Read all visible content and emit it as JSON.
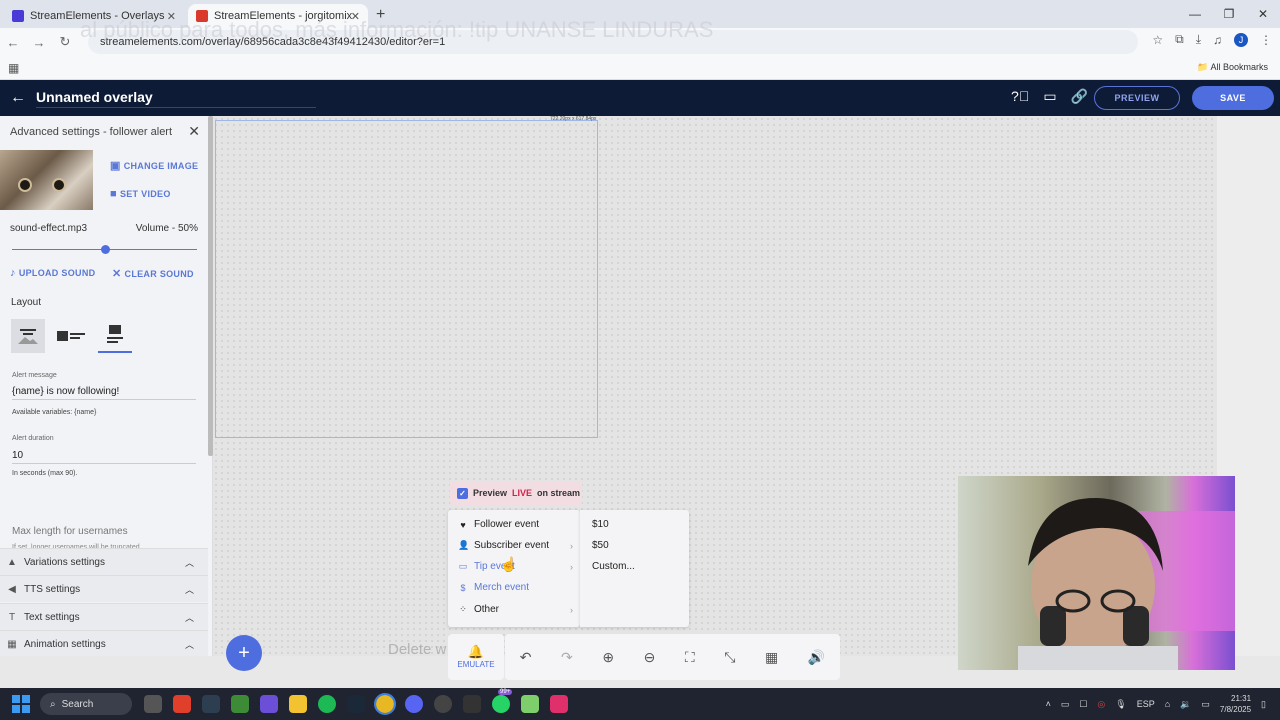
{
  "browser": {
    "tabs": [
      {
        "title": "StreamElements - Overlays"
      },
      {
        "title": "StreamElements - jorgitomix"
      }
    ],
    "url": "streamelements.com/overlay/68956cada3c8e43f49412430/editor?er=1",
    "overlay_ghost_text": "al público para todos, más información: !tip UNANSE LINDURAS",
    "all_bookmarks": "All Bookmarks",
    "profile_initial": "J"
  },
  "header": {
    "title": "Unnamed overlay",
    "preview_label": "PREVIEW",
    "save_label": "SAVE"
  },
  "sidebar": {
    "heading": "Advanced settings - follower alert",
    "change_image": "CHANGE IMAGE",
    "set_video": "SET VIDEO",
    "sound_file": "sound-effect.mp3",
    "volume_label": "Volume - 50%",
    "volume_value": 0.5,
    "upload_sound": "UPLOAD SOUND",
    "clear_sound": "CLEAR SOUND",
    "layout_label": "Layout",
    "alert_message_label": "Alert message",
    "alert_message_value": "{name} is now following!",
    "available_variables": "Available variables: {name}",
    "alert_duration_label": "Alert duration",
    "alert_duration_value": "10",
    "duration_hint": "In seconds (max 90).",
    "max_length_label": "Max length for usernames",
    "max_length_hint": "If set, longer usernames will be truncated",
    "sections": [
      {
        "label": "Variations settings"
      },
      {
        "label": "TTS settings"
      },
      {
        "label": "Text settings"
      },
      {
        "label": "Animation settings"
      }
    ]
  },
  "canvas": {
    "dimension_label": "722.20px x 617.84px",
    "ghost_text": "Delete w"
  },
  "emulate": {
    "preview_live_prefix": "Preview",
    "preview_live_live": "LIVE",
    "preview_live_suffix": "on stream",
    "menu": [
      {
        "label": "Follower event"
      },
      {
        "label": "Subscriber event"
      },
      {
        "label": "Tip event"
      },
      {
        "label": "Merch event"
      },
      {
        "label": "Other"
      }
    ],
    "submenu": [
      {
        "label": "$10"
      },
      {
        "label": "$50"
      },
      {
        "label": "Custom..."
      }
    ],
    "emulate_label": "EMULATE"
  },
  "taskbar": {
    "search_label": "Search",
    "badge": "99+",
    "lang": "ESP",
    "time": "21:31",
    "date": "7/8/2025"
  },
  "colors": {
    "accent": "#4e6ee0",
    "header_bg": "#0e1b36",
    "live_red": "#d0234a"
  }
}
